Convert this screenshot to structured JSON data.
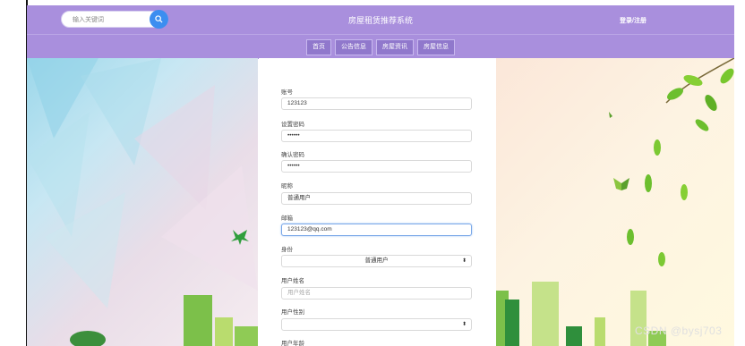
{
  "header": {
    "search_placeholder": "输入关键词",
    "site_title": "房屋租赁推荐系统",
    "login_register": "登录/注册"
  },
  "nav": {
    "items": [
      "首页",
      "公告信息",
      "房屋资讯",
      "房屋信息"
    ]
  },
  "form": {
    "fields": [
      {
        "label": "账号",
        "value": "123123",
        "placeholder": ""
      },
      {
        "label": "设置密码",
        "value": "••••••",
        "placeholder": ""
      },
      {
        "label": "确认密码",
        "value": "••••••",
        "placeholder": ""
      },
      {
        "label": "昵称",
        "value": "普通用户",
        "placeholder": ""
      },
      {
        "label": "邮箱",
        "value": "123123@qq.com",
        "placeholder": ""
      },
      {
        "label": "身份",
        "value": "普通用户",
        "placeholder": ""
      },
      {
        "label": "用户姓名",
        "value": "",
        "placeholder": "用户姓名"
      },
      {
        "label": "用户性别",
        "value": "",
        "placeholder": ""
      },
      {
        "label": "用户年龄",
        "value": "",
        "placeholder": ""
      }
    ]
  },
  "watermark": "CSDN @bysj703",
  "colors": {
    "header_bg": "#a98fdd",
    "search_button": "#3c8ef0",
    "focus_border": "#7aa8e8"
  }
}
